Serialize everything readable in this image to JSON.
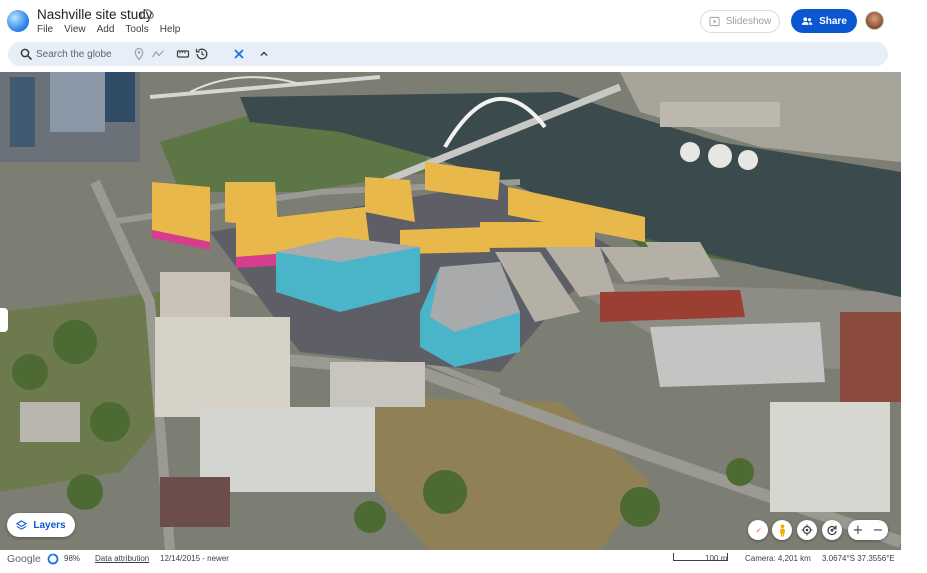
{
  "app": {
    "title": "Nashville site study",
    "menu": [
      "File",
      "View",
      "Add",
      "Tools",
      "Help"
    ],
    "slideshow_label": "Slideshow",
    "share_label": "Share"
  },
  "toolbar": {
    "search_placeholder": "Search the globe",
    "icons": [
      "search-icon",
      "placemark-icon",
      "path-icon",
      "ruler-icon",
      "history-icon",
      "satellite-icon",
      "chevron-up-icon"
    ]
  },
  "map": {
    "layers_label": "Layers",
    "controls": [
      "compass-icon",
      "pegman-icon",
      "location-icon",
      "rotate-icon"
    ],
    "zoom_in": "+",
    "zoom_out": "−"
  },
  "status": {
    "brand": "Google",
    "loading_percent": "98%",
    "loading_fraction": 0.98,
    "attribution": "Data attribution",
    "imagery_date": "12/14/2015 - newer",
    "scale_label": "100 m",
    "camera": "Camera: 4,201 km",
    "coordinates": "3.0674°S 37.3556°E"
  },
  "colors": {
    "accent": "#0b57d0",
    "toolbar_bg": "#e8eef7",
    "yellow_massing": "#e8b84a",
    "teal_massing": "#4ab5c9",
    "magenta_massing": "#d63d8c",
    "river": "#3b4a4c"
  }
}
